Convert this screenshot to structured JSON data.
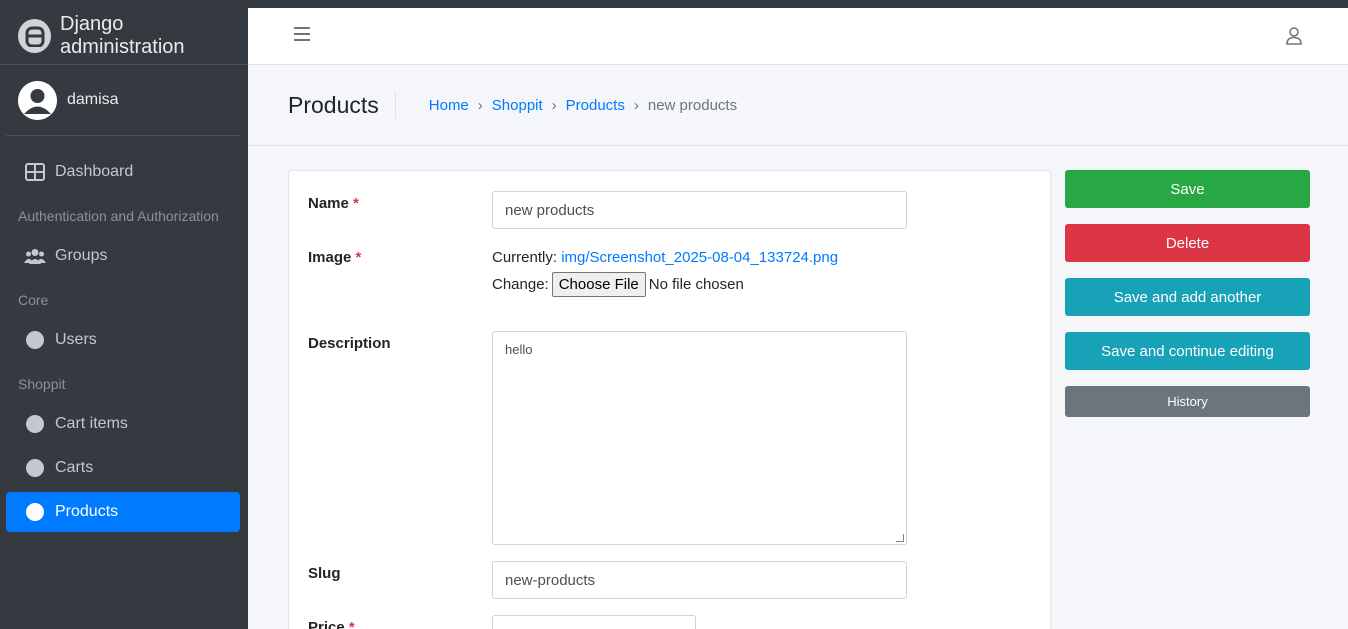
{
  "brand": {
    "title": "Django administration",
    "logo_icon": "django-admin-logo-icon"
  },
  "user": {
    "name": "damisa"
  },
  "sidebar": {
    "dashboard": "Dashboard",
    "sections": [
      {
        "header": "Authentication and Authorization",
        "items": [
          "Groups"
        ]
      },
      {
        "header": "Core",
        "items": [
          "Users"
        ]
      },
      {
        "header": "Shoppit",
        "items": [
          "Cart items",
          "Carts",
          "Products"
        ]
      }
    ],
    "active_item": "Products"
  },
  "header": {
    "page_title": "Products",
    "breadcrumb": {
      "home": "Home",
      "app": "Shoppit",
      "model": "Products",
      "current": "new products",
      "separator": "›"
    }
  },
  "form": {
    "name": {
      "label": "Name",
      "required": "*",
      "value": "new products"
    },
    "image": {
      "label": "Image",
      "required": "*",
      "currently_label": "Currently:",
      "currently_link": "img/Screenshot_2025-08-04_133724.png",
      "change_label": "Change:",
      "choose_button": "Choose File",
      "no_file": "No file chosen"
    },
    "description": {
      "label": "Description",
      "value": "hello"
    },
    "slug": {
      "label": "Slug",
      "value": "new-products"
    },
    "price": {
      "label": "Price",
      "required": "*"
    }
  },
  "actions": {
    "save": "Save",
    "delete": "Delete",
    "save_add_another": "Save and add another",
    "save_continue": "Save and continue editing",
    "history": "History"
  },
  "colors": {
    "sidebar": "#343a40",
    "primary": "#007bff",
    "success": "#28a745",
    "danger": "#dc3545",
    "info": "#17a2b8",
    "secondary": "#6c757d"
  }
}
